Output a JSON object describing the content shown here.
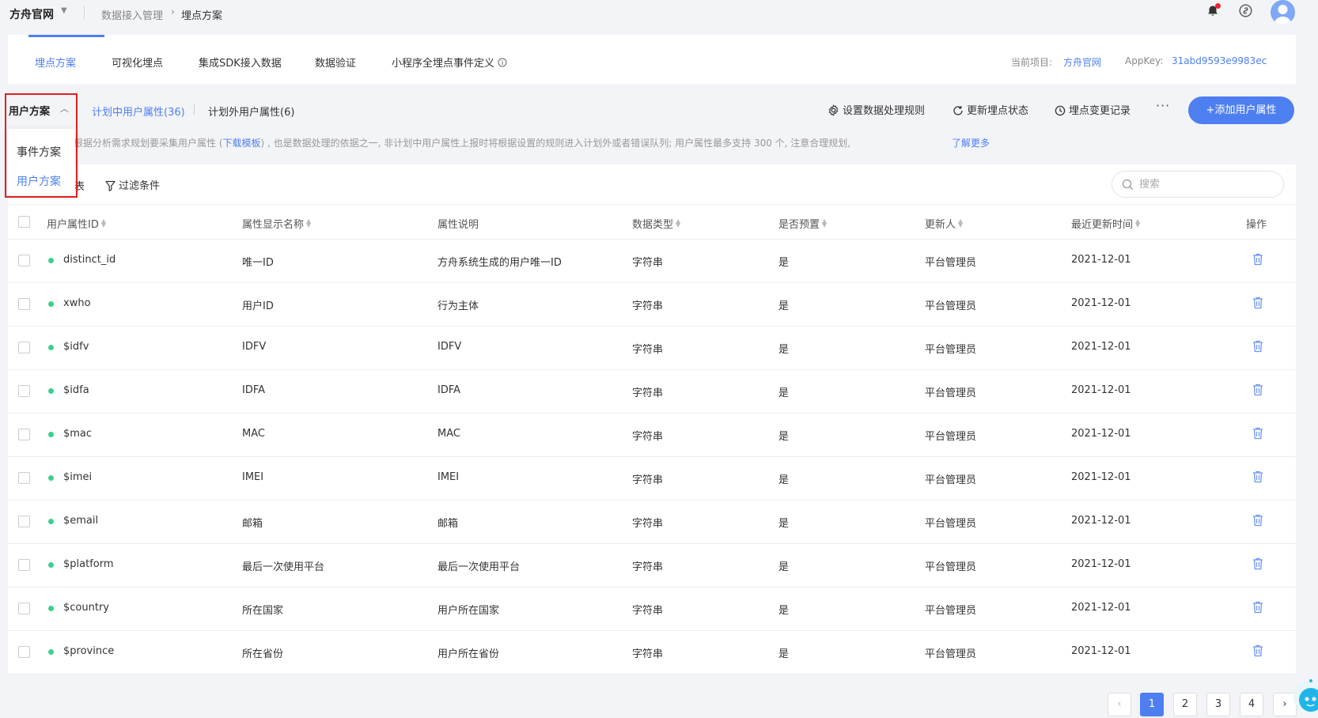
{
  "header": {
    "brand": "方舟官网",
    "breadcrumb": [
      "数据接入管理",
      "埋点方案"
    ]
  },
  "tabs": [
    {
      "label": "埋点方案",
      "active": true
    },
    {
      "label": "可视化埋点",
      "active": false
    },
    {
      "label": "集成SDK接入数据",
      "active": false
    },
    {
      "label": "数据验证",
      "active": false
    },
    {
      "label": "小程序全埋点事件定义",
      "active": false
    }
  ],
  "project": {
    "label": "当前项目:",
    "value": "方舟官网",
    "appkey_label": "AppKey:",
    "appkey_value": "31abd9593e9983ec"
  },
  "toolbar": {
    "plan_selector": "用户方案",
    "sub_tab_planned": "计划中用户属性(36)",
    "sub_tab_unplanned": "计划外用户属性(6)",
    "rule_label": "设置数据处理规则",
    "refresh_label": "更新埋点状态",
    "history_label": "埋点变更记录",
    "more_label": "···",
    "add_label": "+添加用户属性"
  },
  "description": {
    "text_before": "根据分析需求规划要采集用户属性 (",
    "download_link": "下载模板",
    "text_after": ") , 也是数据处理的依据之一, 非计划中用户属性上报时将根据设置的规则进入计划外或者错误队列; 用户属性最多支持 300 个, 注意合理规划,",
    "learn_more": "了解更多"
  },
  "filter_bar": {
    "partial_text": "表",
    "filter_label": "过滤条件",
    "search_placeholder": "搜索"
  },
  "dropdown": {
    "items": [
      {
        "label": "事件方案",
        "selected": false
      },
      {
        "label": "用户方案",
        "selected": true
      }
    ]
  },
  "table": {
    "columns": [
      "用户属性ID",
      "属性显示名称",
      "属性说明",
      "数据类型",
      "是否预置",
      "更新人",
      "最近更新时间",
      "操作"
    ],
    "rows": [
      {
        "id": "distinct_id",
        "name": "唯一ID",
        "desc": "方舟系统生成的用户唯一ID",
        "type": "字符串",
        "preset": "是",
        "updater": "平台管理员",
        "time": "2021-12-01"
      },
      {
        "id": "xwho",
        "name": "用户ID",
        "desc": "行为主体",
        "type": "字符串",
        "preset": "是",
        "updater": "平台管理员",
        "time": "2021-12-01"
      },
      {
        "id": "$idfv",
        "name": "IDFV",
        "desc": "IDFV",
        "type": "字符串",
        "preset": "是",
        "updater": "平台管理员",
        "time": "2021-12-01"
      },
      {
        "id": "$idfa",
        "name": "IDFA",
        "desc": "IDFA",
        "type": "字符串",
        "preset": "是",
        "updater": "平台管理员",
        "time": "2021-12-01"
      },
      {
        "id": "$mac",
        "name": "MAC",
        "desc": "MAC",
        "type": "字符串",
        "preset": "是",
        "updater": "平台管理员",
        "time": "2021-12-01"
      },
      {
        "id": "$imei",
        "name": "IMEI",
        "desc": "IMEI",
        "type": "字符串",
        "preset": "是",
        "updater": "平台管理员",
        "time": "2021-12-01"
      },
      {
        "id": "$email",
        "name": "邮箱",
        "desc": "邮箱",
        "type": "字符串",
        "preset": "是",
        "updater": "平台管理员",
        "time": "2021-12-01"
      },
      {
        "id": "$platform",
        "name": "最后一次使用平台",
        "desc": "最后一次使用平台",
        "type": "字符串",
        "preset": "是",
        "updater": "平台管理员",
        "time": "2021-12-01"
      },
      {
        "id": "$country",
        "name": "所在国家",
        "desc": "用户所在国家",
        "type": "字符串",
        "preset": "是",
        "updater": "平台管理员",
        "time": "2021-12-01"
      },
      {
        "id": "$province",
        "name": "所在省份",
        "desc": "用户所在省份",
        "type": "字符串",
        "preset": "是",
        "updater": "平台管理员",
        "time": "2021-12-01"
      }
    ]
  },
  "pagination": {
    "pages": [
      "1",
      "2",
      "3",
      "4"
    ],
    "current": "1",
    "prev": "‹",
    "next": "›"
  },
  "colors": {
    "accent": "#4e7ff0",
    "status_dot": "#3ecf8e",
    "highlight_border": "#e02020"
  }
}
